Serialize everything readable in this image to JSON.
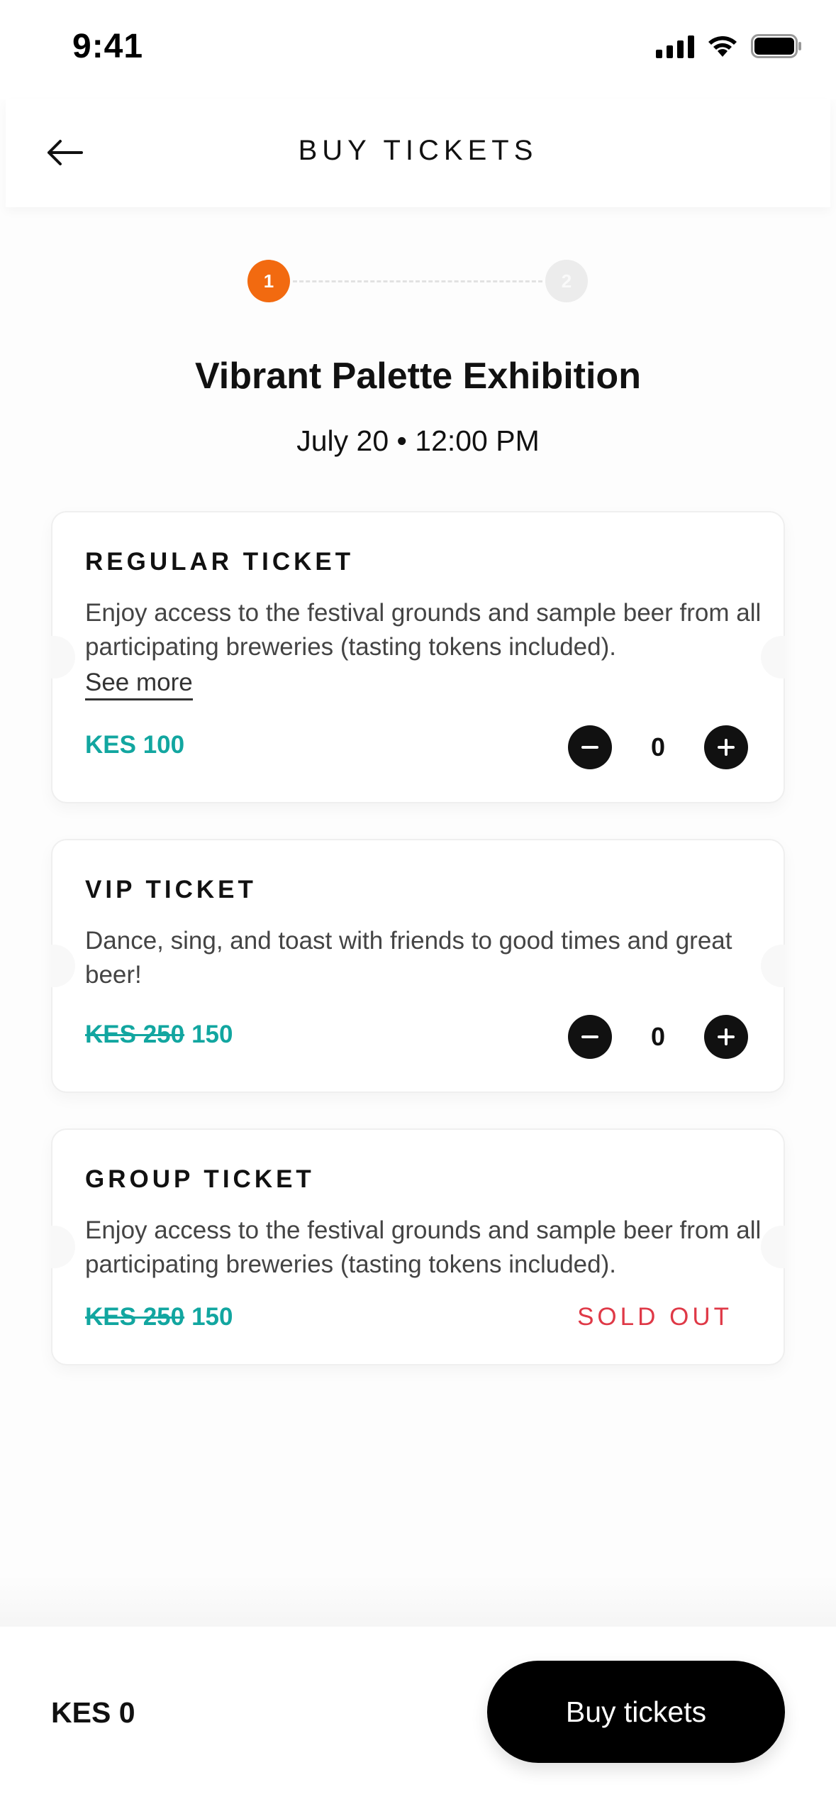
{
  "status_bar": {
    "time": "9:41"
  },
  "header": {
    "title": "BUY TICKETS"
  },
  "stepper": {
    "steps": [
      "1",
      "2"
    ],
    "active_step": 1,
    "active_color": "#f26a10"
  },
  "event": {
    "title": "Vibrant Palette Exhibition",
    "datetime": "July 20 • 12:00 PM"
  },
  "tickets": [
    {
      "title": "REGULAR TICKET",
      "description": "Enjoy access to the festival grounds and sample beer from all participating breweries (tasting tokens included).",
      "see_more": "See more",
      "price": "KES 100",
      "quantity": "0"
    },
    {
      "title": "VIP TICKET",
      "description": "Dance, sing, and toast with friends to good times and great beer!",
      "old_price": "KES 250",
      "price": "150",
      "quantity": "0"
    },
    {
      "title": "GROUP TICKET",
      "description": "Enjoy access to the festival grounds and sample beer from all participating breweries (tasting tokens included).",
      "old_price": "KES 250",
      "price": "150",
      "status": "SOLD OUT"
    }
  ],
  "colors": {
    "price": "#12a6a0",
    "sold_out": "#df3947",
    "button": "#000000"
  },
  "footer": {
    "total": "KES 0",
    "buy_label": "Buy tickets"
  }
}
